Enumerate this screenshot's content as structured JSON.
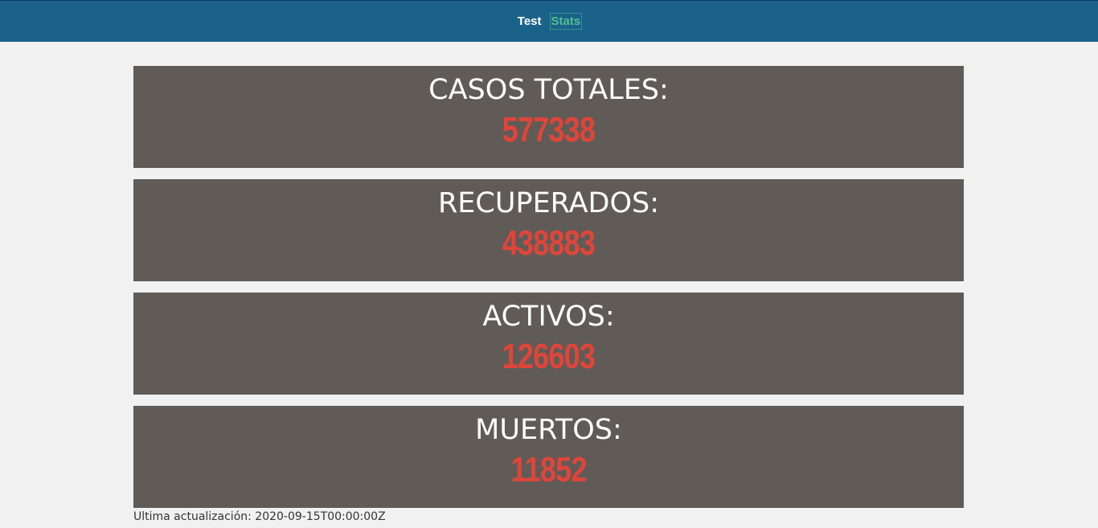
{
  "nav": {
    "items": [
      {
        "label": "Test"
      },
      {
        "label": "Stats"
      }
    ]
  },
  "cards": [
    {
      "label": "CASOS TOTALES:",
      "value": "577338"
    },
    {
      "label": "RECUPERADOS:",
      "value": "438883"
    },
    {
      "label": "ACTIVOS:",
      "value": "126603"
    },
    {
      "label": "MUERTOS:",
      "value": "11852"
    }
  ],
  "footer": {
    "last_update": "Ultima actualización: 2020-09-15T00:00:00Z"
  },
  "colors": {
    "header_bg": "#1b628b",
    "card_bg": "#605b57",
    "value_color": "#e0453a",
    "active_link": "#4fc08d"
  }
}
